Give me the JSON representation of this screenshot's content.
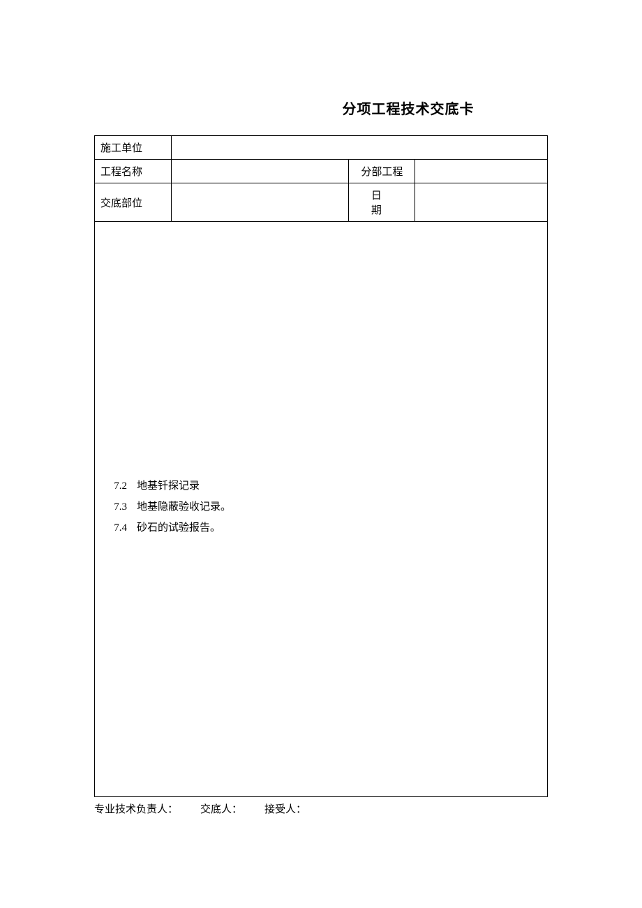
{
  "title": "分项工程技术交底卡",
  "header": {
    "row1_label": "施工单位",
    "row1_value": "",
    "row2_label": "工程名称",
    "row2_value": "",
    "row2_label2": "分部工程",
    "row2_value2": "",
    "row3_label": "交底部位",
    "row3_value": "",
    "row3_label2": "日　期",
    "row3_value2": ""
  },
  "content": {
    "items": [
      {
        "num": "7.2",
        "text": "地基钎探记录"
      },
      {
        "num": "7.3",
        "text": "地基隐蔽验收记录。"
      },
      {
        "num": "7.4",
        "text": "砂石的试验报告。"
      }
    ]
  },
  "footer": {
    "responsible": "专业技术负责人：",
    "disclosure": "交底人：",
    "receiver": "接受人："
  }
}
